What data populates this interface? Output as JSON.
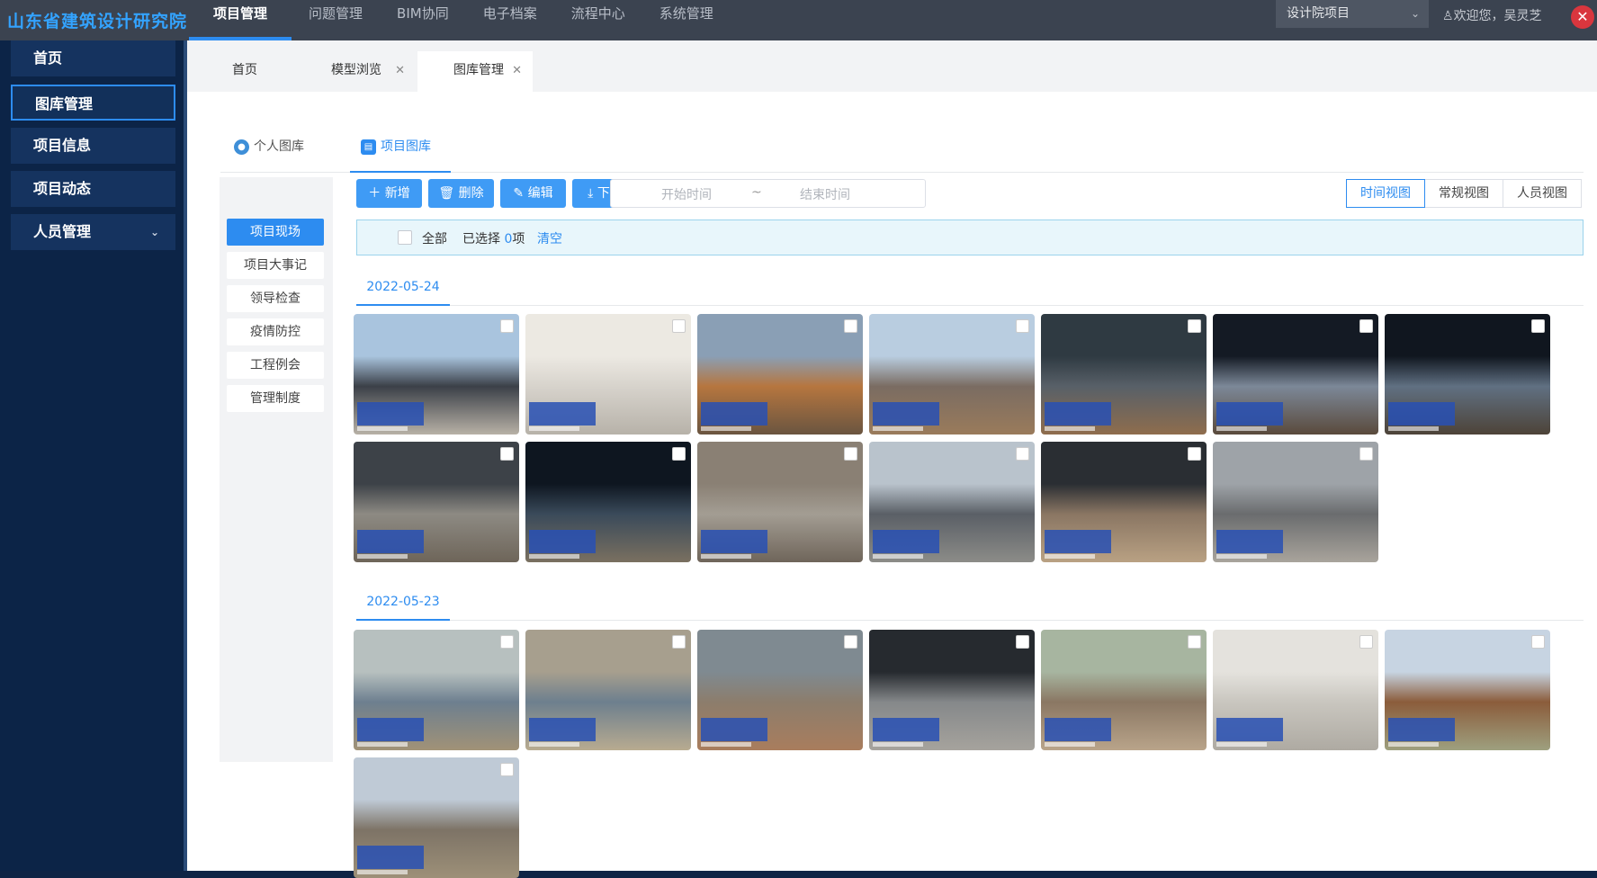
{
  "app": {
    "logo": "山东省建筑设计研究院",
    "top_nav": [
      "项目管理",
      "问题管理",
      "BIM协同",
      "电子档案",
      "流程中心",
      "系统管理"
    ],
    "project_select": "设计院项目",
    "welcome": "欢迎您，吴灵芝"
  },
  "sidebar": {
    "items": [
      {
        "label": "首页"
      },
      {
        "label": "图库管理"
      },
      {
        "label": "项目信息"
      },
      {
        "label": "项目动态"
      },
      {
        "label": "人员管理"
      }
    ]
  },
  "tabs": [
    {
      "label": "首页"
    },
    {
      "label": "模型浏览"
    },
    {
      "label": "图库管理"
    }
  ],
  "subtabs": [
    {
      "label": "个人图库"
    },
    {
      "label": "项目图库"
    }
  ],
  "categories": [
    "项目现场",
    "项目大事记",
    "领导检查",
    "疫情防控",
    "工程例会",
    "管理制度"
  ],
  "toolbar": {
    "add": "新增",
    "delete": "删除",
    "edit": "编辑",
    "download": "下载",
    "start_placeholder": "开始时间",
    "sep": "~",
    "end_placeholder": "结束时间"
  },
  "views": [
    "时间视图",
    "常规视图",
    "人员视图"
  ],
  "selection": {
    "all": "全部",
    "selected_prefix": "已选择",
    "selected_count": "0",
    "selected_suffix": "项",
    "clear": "清空"
  },
  "groups": [
    {
      "date": "2022-05-24",
      "photos": [
        {
          "colors": [
            "#a9c4de",
            "#3b4048",
            "#b8b1a6"
          ]
        },
        {
          "colors": [
            "#ece9e2",
            "#d7d3cc",
            "#b7b2a9"
          ]
        },
        {
          "colors": [
            "#8a9fb5",
            "#b6763f",
            "#6a5540"
          ]
        },
        {
          "colors": [
            "#b9cde0",
            "#7a6c62",
            "#9a7b5b"
          ]
        },
        {
          "colors": [
            "#2f3a42",
            "#586068",
            "#8f6d4d"
          ]
        },
        {
          "colors": [
            "#141a24",
            "#7c8898",
            "#5a4a3c"
          ]
        },
        {
          "colors": [
            "#10161f",
            "#607082",
            "#4d4338"
          ]
        },
        {
          "colors": [
            "#3d4248",
            "#8d8a83",
            "#6e6559"
          ]
        },
        {
          "colors": [
            "#0e1620",
            "#3a4a5a",
            "#7a7060"
          ]
        },
        {
          "colors": [
            "#8a8074",
            "#a39d93",
            "#6f655a"
          ]
        },
        {
          "colors": [
            "#b9c3cc",
            "#5a5f66",
            "#8c8c88"
          ]
        },
        {
          "colors": [
            "#2a2e33",
            "#8a7663",
            "#b9a183"
          ]
        },
        {
          "colors": [
            "#9ea3a8",
            "#6a6c6e",
            "#a9a49c"
          ]
        }
      ]
    },
    {
      "date": "2022-05-23",
      "photos": [
        {
          "colors": [
            "#b7c0bf",
            "#6d7f8f",
            "#a19277"
          ]
        },
        {
          "colors": [
            "#a79f8e",
            "#6d7f8e",
            "#b8ab90"
          ]
        },
        {
          "colors": [
            "#7f8a91",
            "#8c7d6c",
            "#a97d5d"
          ]
        },
        {
          "colors": [
            "#262a2f",
            "#85888a",
            "#a6a39d"
          ]
        },
        {
          "colors": [
            "#a7b5a0",
            "#8a7763",
            "#b9a48a"
          ]
        },
        {
          "colors": [
            "#e4e2dd",
            "#c9c6bf",
            "#aeaaa2"
          ]
        },
        {
          "colors": [
            "#c7d4e2",
            "#8b5c3b",
            "#9ea07f"
          ]
        },
        {
          "colors": [
            "#bfcad6",
            "#7d7366",
            "#9d9078"
          ]
        }
      ]
    }
  ]
}
